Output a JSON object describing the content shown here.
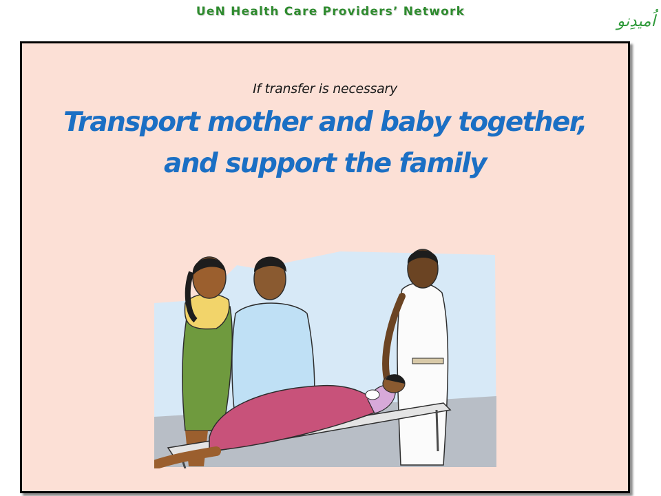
{
  "header": {
    "network_title": "UeN Health Care Providers’ Network",
    "logo_text": "اُمیدِنو"
  },
  "slide": {
    "subtitle": "If transfer  is necessary",
    "headline_line1": "Transport mother and baby together,",
    "headline_line2": "and support the family"
  },
  "colors": {
    "header_green": "#2e8b2e",
    "slide_background": "#fce0d6",
    "headline_blue": "#1b6fc4",
    "logo_green": "#2f9a3a"
  },
  "illustration": {
    "icon": "patient-transfer-illustration"
  }
}
